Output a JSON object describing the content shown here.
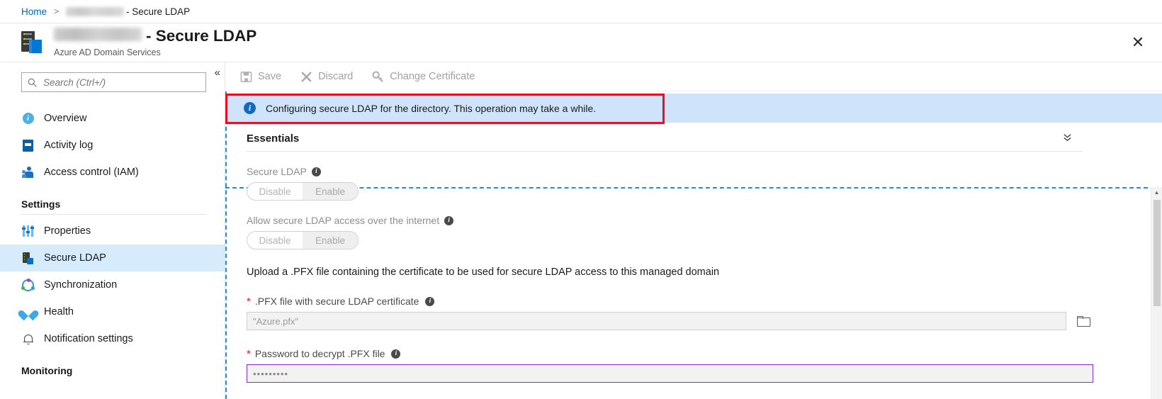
{
  "breadcrumb": {
    "home": "Home",
    "separator": ">",
    "resource_redacted": true,
    "tail": "- Secure LDAP"
  },
  "blade_header": {
    "resource_name_redacted": true,
    "title_suffix": "- Secure LDAP",
    "subtitle": "Azure AD Domain Services",
    "close_label": "✕",
    "icon": "domain-services-icon"
  },
  "sidebar": {
    "collapse_icon": "«",
    "search": {
      "placeholder": "Search (Ctrl+/)",
      "value": "",
      "icon": "search-icon"
    },
    "items": [
      {
        "label": "Overview",
        "icon": "info-icon",
        "selected": false
      },
      {
        "label": "Activity log",
        "icon": "activity-log-icon",
        "selected": false
      },
      {
        "label": "Access control (IAM)",
        "icon": "access-control-icon",
        "selected": false
      }
    ],
    "groups": [
      {
        "title": "Settings",
        "items": [
          {
            "label": "Properties",
            "icon": "properties-icon",
            "selected": false
          },
          {
            "label": "Secure LDAP",
            "icon": "secure-ldap-icon",
            "selected": true
          },
          {
            "label": "Synchronization",
            "icon": "synchronization-icon",
            "selected": false
          },
          {
            "label": "Health",
            "icon": "health-icon",
            "selected": false
          },
          {
            "label": "Notification settings",
            "icon": "bell-icon",
            "selected": false
          }
        ]
      },
      {
        "title": "Monitoring",
        "items": []
      }
    ]
  },
  "toolbar": {
    "save_label": "Save",
    "save_icon": "save-icon",
    "discard_label": "Discard",
    "discard_icon": "close-x-icon",
    "change_cert_label": "Change Certificate",
    "change_cert_icon": "key-icon",
    "disabled": true
  },
  "banner": {
    "text": "Configuring secure LDAP for the directory. This operation may take a while.",
    "icon": "info-icon",
    "background": "#cfe4fa",
    "highlight_color": "#e81123"
  },
  "essentials": {
    "label": "Essentials",
    "chevron_icon": "chevron-double-down-icon",
    "chevron_glyph": "»"
  },
  "form": {
    "secure_ldap": {
      "label": "Secure LDAP",
      "info_icon": "info-icon",
      "options": [
        "Disable",
        "Enable"
      ],
      "selected": "Enable",
      "disabled": true
    },
    "internet_access": {
      "label": "Allow secure LDAP access over the internet",
      "info_icon": "info-icon",
      "options": [
        "Disable",
        "Enable"
      ],
      "selected": "Enable",
      "disabled": true
    },
    "upload_instructions": "Upload a .PFX file containing the certificate to be used for secure LDAP access to this managed domain",
    "pfx_file": {
      "required_marker": "*",
      "label": ".PFX file with secure LDAP certificate",
      "info_icon": "info-icon",
      "placeholder": "\"Azure.pfx\"",
      "value": "",
      "browse_icon": "folder-icon"
    },
    "pfx_password": {
      "required_marker": "*",
      "label": "Password to decrypt .PFX file",
      "info_icon": "info-icon",
      "value": "•••••••••",
      "placeholder": "",
      "focus_border_color": "#8a2be2"
    }
  },
  "scrollbar": {
    "up_icon": "chevron-up-icon",
    "down_icon": "chevron-down-icon"
  }
}
